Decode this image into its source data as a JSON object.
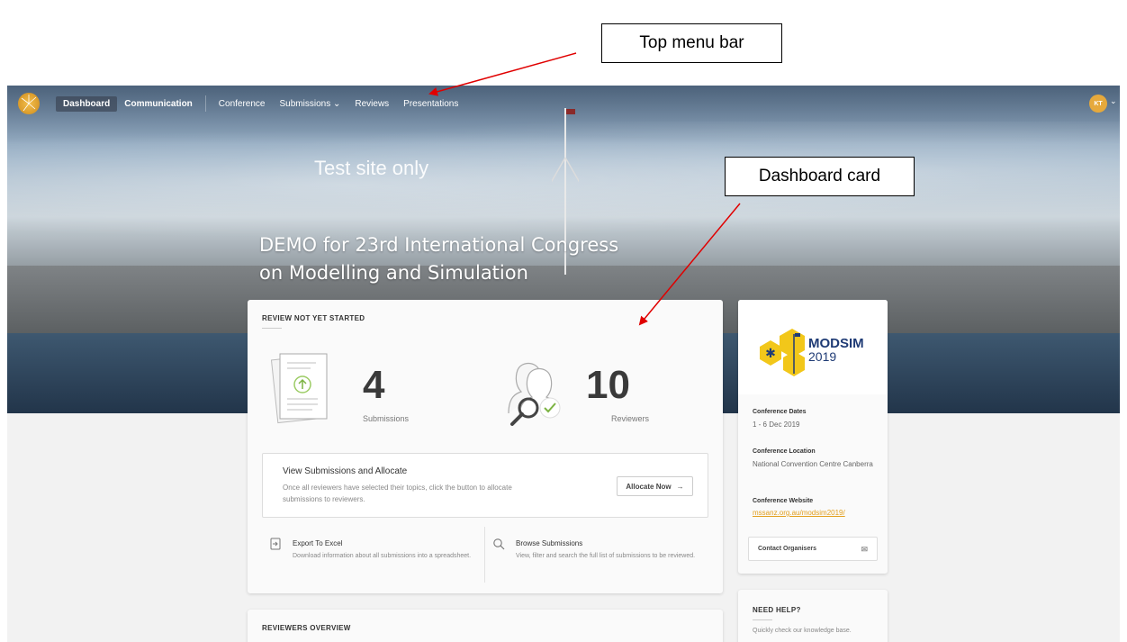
{
  "annotations": {
    "top_menu_bar": "Top menu bar",
    "dashboard_card": "Dashboard card"
  },
  "topbar": {
    "nav": [
      "Dashboard",
      "Communication",
      "Conference",
      "Submissions",
      "Reviews",
      "Presentations"
    ],
    "submissions_chevron": "⌄",
    "avatar_initials": "KT"
  },
  "hero": {
    "watermark": "Test site only",
    "title": "DEMO for 23rd International Congress on Modelling and Simulation"
  },
  "review_card": {
    "title": "REVIEW NOT YET STARTED",
    "submissions_count": "4",
    "submissions_label": "Submissions",
    "reviewers_count": "10",
    "reviewers_label": "Reviewers",
    "allocate_title": "View Submissions and Allocate",
    "allocate_desc": "Once all reviewers have selected their topics, click the button to allocate submissions to reviewers.",
    "allocate_button": "Allocate Now",
    "export_title": "Export To Excel",
    "export_desc": "Download information about all submissions into a spreadsheet.",
    "browse_title": "Browse Submissions",
    "browse_desc": "View, filter and search the full list of submissions to be reviewed."
  },
  "reviewers_card": {
    "title": "REVIEWERS OVERVIEW"
  },
  "side": {
    "logo_text": "MODSIM",
    "logo_year": "2019",
    "dates_label": "Conference Dates",
    "dates_value": "1 - 6 Dec 2019",
    "location_label": "Conference Location",
    "location_value": "National Convention Centre Canberra",
    "website_label": "Conference Website",
    "website_value": "mssanz.org.au/modsim2019/",
    "contact_button": "Contact Organisers"
  },
  "help": {
    "title": "NEED HELP?",
    "text": "Quickly check our knowledge base."
  },
  "colors": {
    "accent": "#e6a93c",
    "link": "#e2a020",
    "arrow": "#e00000"
  }
}
